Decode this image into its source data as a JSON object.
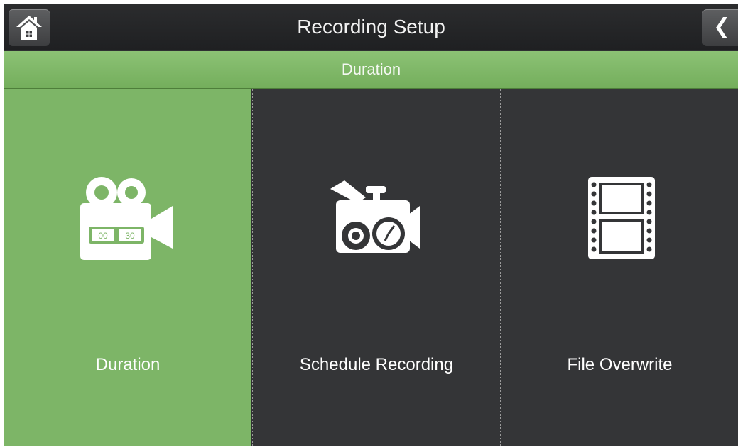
{
  "header": {
    "title": "Recording Setup",
    "home_icon": "home-icon",
    "back_icon": "chevron-left-icon"
  },
  "subheader": {
    "title": "Duration"
  },
  "tiles": [
    {
      "label": "Duration",
      "icon": "video-camera-timer-icon",
      "selected": true,
      "timer_left": "00",
      "timer_right": "30"
    },
    {
      "label": "Schedule Recording",
      "icon": "camera-clock-icon",
      "selected": false
    },
    {
      "label": "File Overwrite",
      "icon": "film-strip-icon",
      "selected": false
    }
  ],
  "colors": {
    "accent": "#7db567",
    "background": "#343537",
    "topbar": "#242527"
  }
}
